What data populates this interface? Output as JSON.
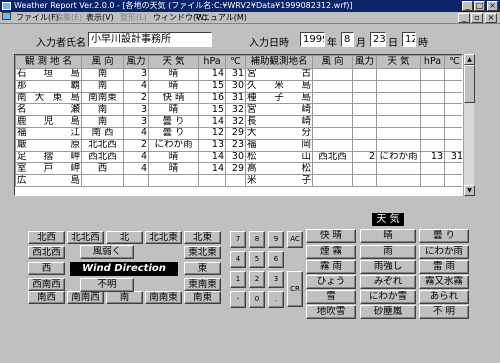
{
  "window": {
    "title": "Weather Report Ver.2.0.0 - [各地の天気 (ファイル名:C:¥WRV2¥Data¥1999082312.wrf)]",
    "min": "_",
    "max": "□",
    "close": "×"
  },
  "menu": {
    "file": "ファイル(F)",
    "edit": "編集(E)",
    "view": "表示(V)",
    "layout": "整形(L)",
    "window": "ウィンドウ(W)",
    "manual": "マニュアル(M)",
    "min": "_",
    "restore": "▫",
    "close": "×"
  },
  "form": {
    "name_label": "入力者氏名",
    "name_value": "小早川設計事務所",
    "date_label": "入力日時",
    "year": "1999",
    "year_unit": "年",
    "month": "8",
    "month_unit": "月",
    "day": "23",
    "day_unit": "日",
    "hour": "12",
    "hour_unit": "時"
  },
  "table": {
    "headers": [
      "観 測 地 名",
      "風 向",
      "風力",
      "天 気",
      "hPa",
      "℃",
      "補助観測地名",
      "風 向",
      "風力",
      "天 気",
      "hPa",
      "℃"
    ],
    "rows": [
      [
        "石 垣 島",
        "南",
        "3",
        "晴",
        "14",
        "31",
        "宮",
        "古",
        "",
        "",
        "",
        "",
        ""
      ],
      [
        "那 覇",
        "南",
        "4",
        "晴",
        "15",
        "30",
        "久 米 島",
        "",
        "",
        "",
        "",
        ""
      ],
      [
        "南 大 東 島",
        "南南東",
        "2",
        "快 晴",
        "16",
        "31",
        "種 子 島",
        "",
        "",
        "",
        "",
        ""
      ],
      [
        "名 瀬",
        "南",
        "3",
        "晴",
        "15",
        "32",
        "宮 崎",
        "",
        "",
        "",
        "",
        ""
      ],
      [
        "鹿 児 島",
        "南",
        "3",
        "曇 り",
        "14",
        "32",
        "長 崎",
        "",
        "",
        "",
        "",
        ""
      ],
      [
        "福 江",
        "南 西",
        "4",
        "曇 り",
        "12",
        "29",
        "大 分",
        "",
        "",
        "",
        "",
        ""
      ],
      [
        "厳 原",
        "北北西",
        "2",
        "にわか雨",
        "13",
        "23",
        "福 岡",
        "",
        "",
        "",
        "",
        ""
      ],
      [
        "足 摺 岬",
        "西北西",
        "4",
        "晴",
        "14",
        "30",
        "松 山",
        "西北西",
        "2",
        "にわか雨",
        "13",
        "31"
      ],
      [
        "室 戸 岬",
        "西",
        "4",
        "晴",
        "14",
        "29",
        "高 松",
        "",
        "",
        "",
        "",
        ""
      ],
      [
        "広 島",
        "",
        "",
        "",
        "",
        "",
        "米 子",
        "",
        "",
        "",
        "",
        ""
      ]
    ]
  },
  "wind": {
    "rows": [
      [
        "北西",
        "北北西",
        "北",
        "北北東",
        "北東"
      ],
      [
        "西北西",
        "",
        "",
        "",
        "東北東"
      ],
      [
        "西",
        "",
        "",
        "",
        "東"
      ],
      [
        "西南西",
        "",
        "",
        "",
        "東南東"
      ],
      [
        "南西",
        "南南西",
        "南",
        "南南東",
        "南東"
      ]
    ],
    "weak": "風弱く",
    "calm": "不明",
    "display_label": "Wind Direction"
  },
  "keypad": {
    "keys": [
      "7",
      "8",
      "9",
      "AC",
      "4",
      "5",
      "6",
      "",
      "1",
      "2",
      "3",
      "CR",
      "-",
      "0",
      "."
    ]
  },
  "weather": {
    "title": "天 気",
    "buttons": [
      "快 晴",
      "晴",
      "曇 り",
      "煙 霧",
      "雨",
      "にわか雨",
      "霧 雨",
      "雨強し",
      "雷 雨",
      "ひょう",
      "みぞれ",
      "霧又氷霧",
      "雪",
      "にわか雪",
      "あられ",
      "地吹雪",
      "砂塵嵐",
      "不 明"
    ]
  }
}
